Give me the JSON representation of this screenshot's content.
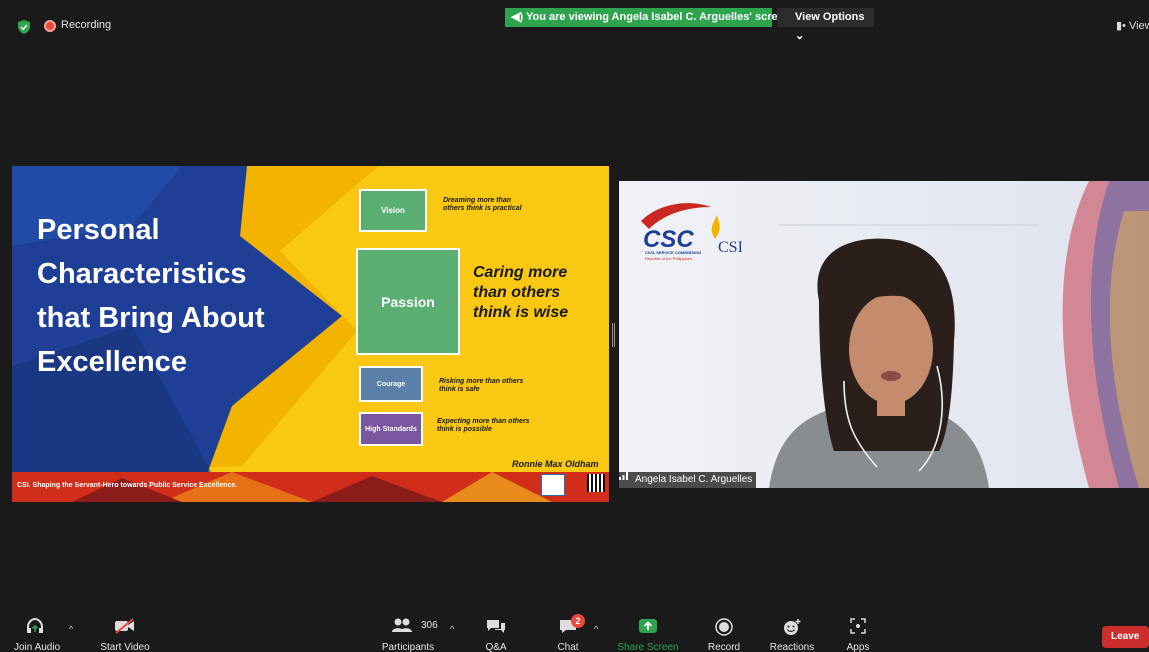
{
  "topbar": {
    "recording_label": "Recording",
    "viewing_banner": "You are viewing Angela Isabel C. Arguelles' screen",
    "view_options": "View Options",
    "view_right": "View"
  },
  "slide": {
    "title": "Personal Characteristics that Bring About Excellence",
    "boxes": {
      "vision": "Vision",
      "passion": "Passion",
      "courage": "Courage",
      "high_standards": "High Standards"
    },
    "quotes": {
      "vision": "Dreaming more than others think is practical",
      "passion": "Caring more than others think is wise",
      "courage": "Risking more than others think is safe",
      "high_standards": "Expecting more than others think is possible"
    },
    "author": "Ronnie Max Oldham",
    "footer": "CSI. Shaping the Servant-Hero towards Public Service Excellence."
  },
  "video": {
    "logo_text": "CSC",
    "logo_sub1": "CIVIL SERVICE COMMISSION",
    "logo_sub2": "Republic of the Philippines",
    "csi_label": "CSI",
    "participant_name": "Angela Isabel C. Arguelles"
  },
  "toolbar": {
    "join_audio": "Join Audio",
    "start_video": "Start Video",
    "participants": "Participants",
    "participants_count": "306",
    "qa": "Q&A",
    "chat": "Chat",
    "chat_badge": "2",
    "share_screen": "Share Screen",
    "record": "Record",
    "reactions": "Reactions",
    "apps": "Apps",
    "leave": "Leave"
  },
  "colors": {
    "share_green": "#2ea44f",
    "leave_red": "#cc2e2e",
    "slide_blue": "#1f3f96",
    "slide_yellow": "#f8c813"
  }
}
